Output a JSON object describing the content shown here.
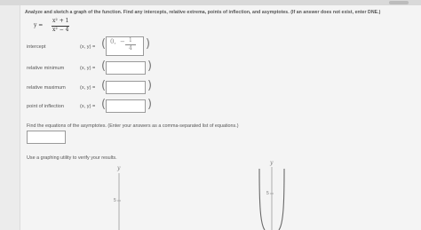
{
  "instructions": "Analyze and sketch a graph of the function. Find any intercepts, relative extrema, points of inflection, and asymptotes. (If an answer does not exist, enter DNE.)",
  "function": {
    "lhs": "y =",
    "numerator": "x² + 1",
    "denominator": "x² − 4"
  },
  "rows": [
    {
      "label": "intercept",
      "xy": "(x, y) =",
      "value": "0,",
      "value_num": "1",
      "value_den": "4",
      "value_sign": "−"
    },
    {
      "label": "relative minimum",
      "xy": "(x, y) =",
      "value": ""
    },
    {
      "label": "relative maximum",
      "xy": "(x, y) =",
      "value": ""
    },
    {
      "label": "point of inflection",
      "xy": "(x, y) =",
      "value": ""
    }
  ],
  "asymptotes": {
    "prompt": "Find the equations of the asymptotes. (Enter your answers as a comma-separated list of equations.)",
    "value": ""
  },
  "graphing_note": "Use a graphing utility to verify your results.",
  "graphs": [
    {
      "axis_label": "y",
      "tick_label": "5"
    },
    {
      "axis_label": "y",
      "tick_label": "5"
    }
  ]
}
